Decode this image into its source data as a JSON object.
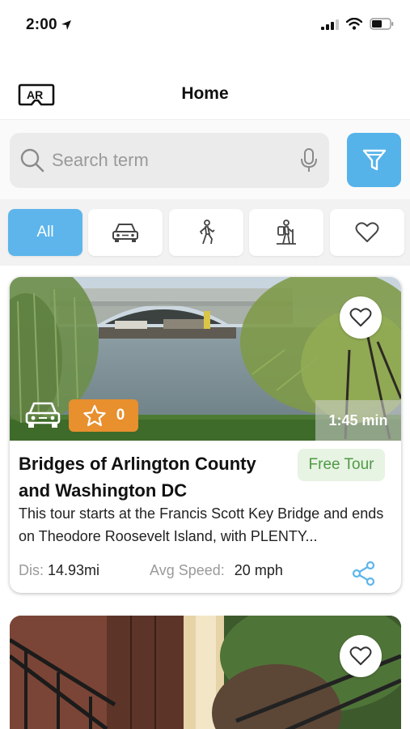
{
  "status": {
    "time": "2:00",
    "icons": [
      "location-arrow-icon",
      "cellular-signal-icon",
      "wifi-icon",
      "battery-icon"
    ]
  },
  "nav": {
    "ar_label": "AR",
    "title": "Home"
  },
  "search": {
    "placeholder": "Search term",
    "value": ""
  },
  "category_tabs": [
    {
      "label": "All",
      "icon": "",
      "active": true
    },
    {
      "label": "",
      "icon": "car-icon",
      "active": false
    },
    {
      "label": "",
      "icon": "walking-icon",
      "active": false
    },
    {
      "label": "",
      "icon": "hiking-icon",
      "active": false
    },
    {
      "label": "",
      "icon": "heart-icon",
      "active": false
    }
  ],
  "tours": [
    {
      "title": "Bridges of Arlington County and Washington DC",
      "price": "Free Tour",
      "rating": "0",
      "duration": "1:45 min",
      "mode_icon": "car-icon",
      "description": "This tour starts at the Francis Scott Key Bridge and ends on Theodore Roosevelt Island, with PLENTY...",
      "distance_label": "Dis:",
      "distance": "14.93mi",
      "speed_label": "Avg Speed:",
      "speed": "20 mph"
    }
  ],
  "colors": {
    "accent": "#55b3ea",
    "rating_badge": "#e88f2e",
    "price_text": "#4f9a45",
    "price_bg": "#e7f3e3"
  }
}
